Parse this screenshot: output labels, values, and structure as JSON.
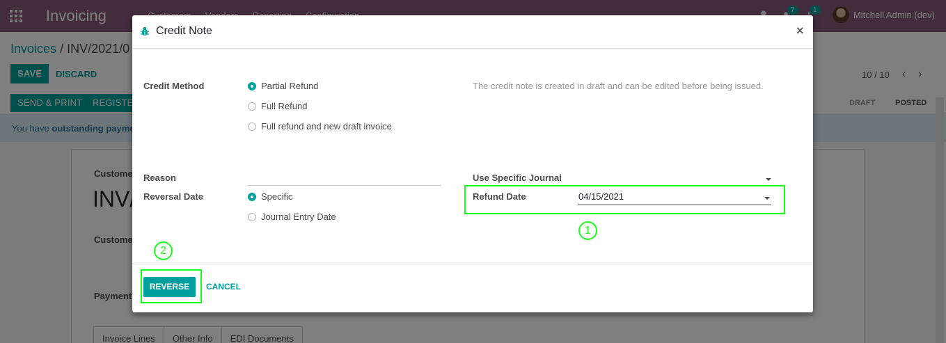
{
  "app": {
    "name": "Invoicing",
    "menu": [
      "Customers",
      "Vendors",
      "Reporting",
      "Configuration"
    ],
    "chat_count": "7",
    "activity_count": "1",
    "user": "Mitchell Admin (dev)"
  },
  "breadcrumb": {
    "parent": "Invoices",
    "separator": "/",
    "current": "INV/2021/0"
  },
  "toolbar": {
    "save": "SAVE",
    "discard": "DISCARD",
    "pager": "10 / 10"
  },
  "actions": {
    "send_print": "SEND & PRINT",
    "register": "REGISTER"
  },
  "status": {
    "draft": "DRAFT",
    "posted": "POSTED"
  },
  "alert": {
    "prefix": "You have ",
    "strong": "outstanding paymen"
  },
  "sheet": {
    "customer_label": "Customer",
    "number_prefix": "INV/",
    "customer_label2": "Customer",
    "payment_label": "Payment",
    "tabs": [
      "Invoice Lines",
      "Other Info",
      "EDI Documents"
    ]
  },
  "dialog": {
    "title": "Credit Note",
    "close": "×",
    "credit_method_label": "Credit Method",
    "credit_methods": [
      "Partial Refund",
      "Full Refund",
      "Full refund and new draft invoice"
    ],
    "credit_method_selected": "Partial Refund",
    "help_text": "The credit note is created in draft and can be edited before being issued.",
    "reason_label": "Reason",
    "reason_value": "",
    "journal_label": "Use Specific Journal",
    "reversal_date_label": "Reversal Date",
    "reversal_options": [
      "Specific",
      "Journal Entry Date"
    ],
    "reversal_selected": "Specific",
    "refund_date_label": "Refund Date",
    "refund_date_value": "04/15/2021",
    "reverse_button": "REVERSE",
    "cancel_button": "CANCEL"
  },
  "annotations": {
    "step1": "1",
    "step2": "2",
    "color": "#1aff1a"
  },
  "colors": {
    "brand": "#875a7b",
    "primary": "#00a09d"
  }
}
